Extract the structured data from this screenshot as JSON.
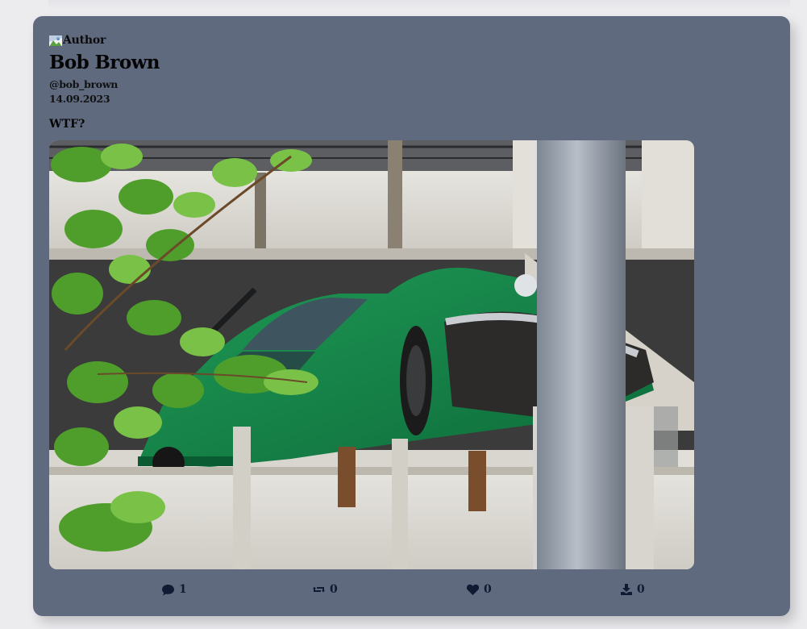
{
  "post": {
    "author_label": "Author",
    "name": "Bob Brown",
    "handle": "@bob_brown",
    "date": "14.09.2023",
    "text": "WTF?"
  },
  "actions": {
    "comments": "1",
    "reposts": "0",
    "likes": "0",
    "downloads": "0"
  },
  "icons": [
    "comment-icon",
    "repost-icon",
    "heart-icon",
    "download-icon"
  ],
  "colors": {
    "page_background": "#ececef",
    "card_background": "#5f6a7e",
    "icon_color": "#101a33"
  }
}
